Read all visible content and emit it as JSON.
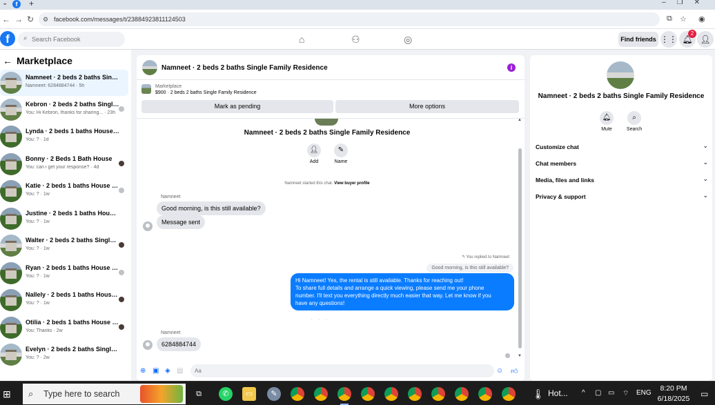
{
  "browser": {
    "url": "facebook.com/messages/t/23884923811124503"
  },
  "header": {
    "search_placeholder": "Search Facebook",
    "find_friends": "Find friends",
    "notification_count": "2"
  },
  "sidebar": {
    "title": "Marketplace",
    "conversations": [
      {
        "name": "Namneet · 2 beds 2 baths Single F...",
        "sub": "Namneet: 6284884744 · 5h"
      },
      {
        "name": "Kebron · 2 beds 2 baths Single F...",
        "sub": "You: Hi Kebron, thanks for sharing... · 23h"
      },
      {
        "name": "Lynda · 2 beds 1 baths House for r...",
        "sub": "You: ? · 1d"
      },
      {
        "name": "Bonny · 2 Beds 1 Bath House",
        "sub": "You: can i get your response? · 4d"
      },
      {
        "name": "Katie · 2 beds 1 baths House for ...",
        "sub": "You: ? · 1w"
      },
      {
        "name": "Justine · 2 beds 1 baths House for ...",
        "sub": "You: ? · 1w"
      },
      {
        "name": "Walter · 2 beds 2 baths Single F...",
        "sub": "You: ? · 1w"
      },
      {
        "name": "Ryan · 2 beds 1 baths House for ...",
        "sub": "You: ? · 1w"
      },
      {
        "name": "Nallely · 2 beds 1 baths House f...",
        "sub": "You: ? · 1w"
      },
      {
        "name": "Otilia · 2 beds 1 baths House for...",
        "sub": "You: Thanks · 2w"
      },
      {
        "name": "Evelyn · 2 beds 2 baths Single Fam...",
        "sub": "You: ? · 2w"
      }
    ]
  },
  "chat": {
    "title": "Namneet · 2 beds 2 baths Single Family Residence",
    "marketplace_label": "Marketplace",
    "listing_price": "$900 · 2 beds 2 baths Single Family Residence",
    "mark_pending": "Mark as pending",
    "more_options": "More options",
    "hero_title": "Namneet · 2 beds 2 baths Single Family Residence",
    "actions": {
      "add": "Add",
      "name": "Name"
    },
    "started_text": "Namneet started this chat.",
    "view_profile": "View buyer profile",
    "sender1": "Namneet",
    "msg1": "Good morning, is this still available?",
    "msg2": "Message sent",
    "replied_to": "You replied to Namneet",
    "quoted": "Good morning, is this still available?",
    "reply_lines": [
      "Hi Namneet! Yes, the rental is still available. Thanks for reaching out!",
      "To share full details and arrange a quick viewing, please send me your phone",
      "number. I'll text you everything directly much easier that way. Let me know if you",
      "have any questions!"
    ],
    "sender2": "Namneet",
    "msg3": "6284884744",
    "composer_placeholder": "Aa"
  },
  "right_panel": {
    "title": "Namneet · 2 beds 2 baths Single Family Residence",
    "mute": "Mute",
    "search": "Search",
    "sections": [
      "Customize chat",
      "Chat members",
      "Media, files and links",
      "Privacy & support"
    ]
  },
  "taskbar": {
    "search_text": "Type here to search",
    "hot_label": "Hot...",
    "language": "ENG",
    "time": "8:20 PM",
    "date": "6/18/2025"
  },
  "colors": {
    "brand": "#1877f2",
    "outgoing_bubble": "#0a7cff",
    "info_icon": "#9b1ed6"
  }
}
